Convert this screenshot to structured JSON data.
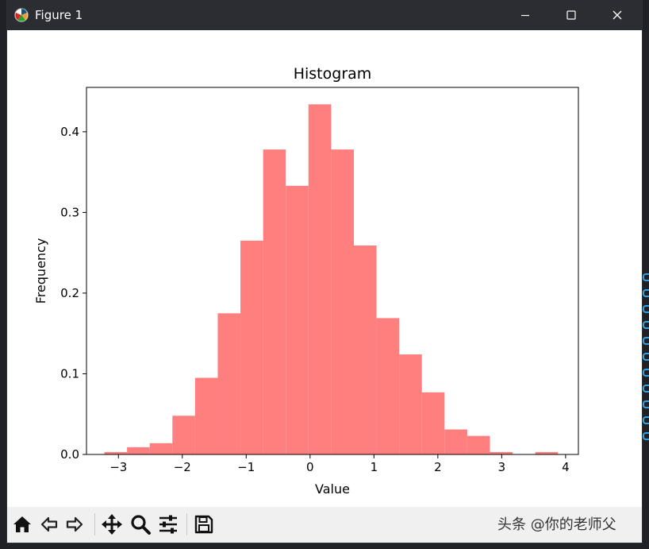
{
  "window": {
    "title": "Figure 1"
  },
  "toolbar": {
    "buttons": [
      {
        "name": "home-button",
        "icon": "home-icon"
      },
      {
        "name": "back-button",
        "icon": "back-arrow-icon"
      },
      {
        "name": "forward-button",
        "icon": "forward-arrow-icon"
      },
      {
        "name": "pan-button",
        "icon": "move-icon"
      },
      {
        "name": "zoom-button",
        "icon": "magnifier-icon"
      },
      {
        "name": "configure-subplots-button",
        "icon": "sliders-icon"
      },
      {
        "name": "save-button",
        "icon": "floppy-disk-icon"
      }
    ],
    "watermark": "头条 @你的老师父"
  },
  "chart_data": {
    "type": "bar",
    "title": "Histogram",
    "xlabel": "Value",
    "ylabel": "Frequency",
    "color": "#ff7f7f",
    "xlim": [
      -3.5,
      4.2
    ],
    "ylim": [
      0,
      0.455
    ],
    "xticks": [
      -3,
      -2,
      -1,
      0,
      1,
      2,
      3,
      4
    ],
    "xtick_labels": [
      "−3",
      "−2",
      "−1",
      "0",
      "1",
      "2",
      "3",
      "4"
    ],
    "yticks": [
      0.0,
      0.1,
      0.2,
      0.3,
      0.4
    ],
    "ytick_labels": [
      "0.0",
      "0.1",
      "0.2",
      "0.3",
      "0.4"
    ],
    "bin_edges": [
      -3.22,
      -2.865,
      -2.51,
      -2.155,
      -1.8,
      -1.445,
      -1.09,
      -0.735,
      -0.38,
      -0.025,
      0.33,
      0.685,
      1.04,
      1.395,
      1.75,
      2.105,
      2.46,
      2.815,
      3.17,
      3.525,
      3.88
    ],
    "values": [
      0.003,
      0.009,
      0.014,
      0.048,
      0.095,
      0.175,
      0.265,
      0.378,
      0.333,
      0.434,
      0.378,
      0.259,
      0.169,
      0.124,
      0.077,
      0.031,
      0.023,
      0.003,
      0.0,
      0.003
    ],
    "grid": false,
    "legend": "none"
  }
}
